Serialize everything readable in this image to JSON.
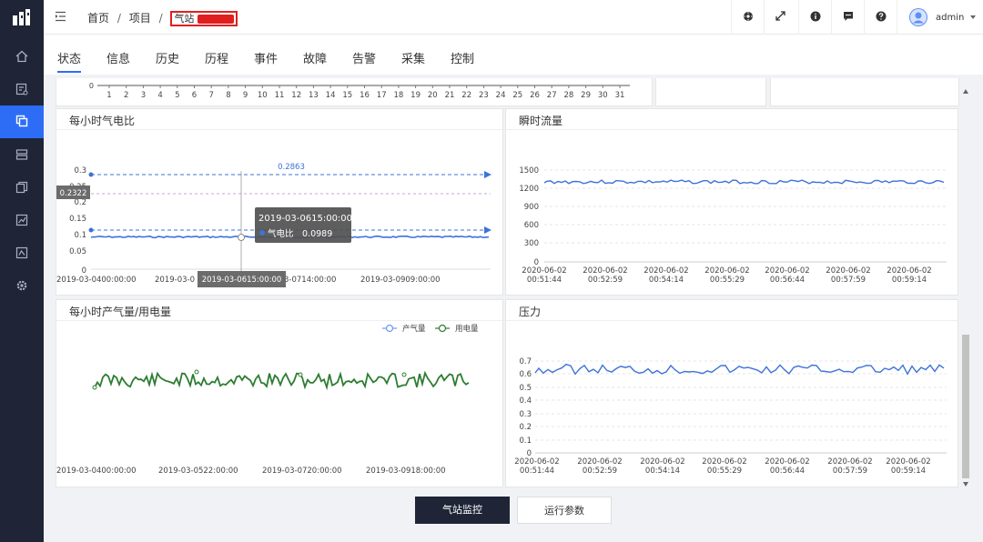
{
  "breadcrumb": {
    "home": "首页",
    "sep1": "/",
    "project": "项目",
    "sep2": "/",
    "station": "气站"
  },
  "user": {
    "name": "admin"
  },
  "topbar_icons": [
    "locate-icon",
    "expand-icon",
    "info-icon",
    "message-icon",
    "help-icon"
  ],
  "sidebar_icons": [
    "home-icon",
    "device-list-icon",
    "station-icon",
    "storage-icon",
    "copy-icon",
    "chart-icon",
    "report-icon",
    "settings-icon"
  ],
  "tabs": [
    "状态",
    "信息",
    "历史",
    "历程",
    "事件",
    "故障",
    "告警",
    "采集",
    "控制"
  ],
  "active_tab": "状态",
  "colors": {
    "accent": "#2d6df6",
    "sidebar_bg": "#1f2536",
    "series_blue": "#3d72d9",
    "series_green": "#2e7d32"
  },
  "top_strip": {
    "y_tick": "0",
    "days": [
      "1",
      "2",
      "3",
      "4",
      "5",
      "6",
      "7",
      "8",
      "9",
      "10",
      "11",
      "12",
      "13",
      "14",
      "15",
      "16",
      "17",
      "18",
      "19",
      "20",
      "21",
      "22",
      "23",
      "24",
      "25",
      "26",
      "27",
      "28",
      "29",
      "30",
      "31"
    ]
  },
  "charts": {
    "gas_ratio": {
      "title": "每小时气电比",
      "y_ticks": [
        "0.3",
        "0.25",
        "0.2",
        "0.15",
        "0.1",
        "0.05",
        "0"
      ],
      "x_labels": [
        "2019-03-0400:00:00",
        "2019-03-0",
        "2019-03-0615:00:00",
        "3-0714:00:00",
        "2019-03-0909:00:00"
      ],
      "markline_top": "0.2863",
      "cursor_y_label": "0.2322",
      "tooltip_time": "2019-03-0615:00:00",
      "tooltip_series": "气电比",
      "tooltip_value": "0.0989",
      "axis_pointer_label": "2019-03-0615:00:00"
    },
    "flow": {
      "title": "瞬时流量",
      "y_ticks": [
        "1500",
        "1200",
        "900",
        "600",
        "300",
        "0"
      ],
      "x_dates": [
        "2020-06-02",
        "2020-06-02",
        "2020-06-02",
        "2020-06-02",
        "2020-06-02",
        "2020-06-02",
        "2020-06-02"
      ],
      "x_times": [
        "00:51:44",
        "00:52:59",
        "00:54:14",
        "00:55:29",
        "00:56:44",
        "00:57:59",
        "00:59:14"
      ]
    },
    "production": {
      "title": "每小时产气量/用电量",
      "legend": [
        "产气量",
        "用电量"
      ],
      "x_labels": [
        "2019-03-0400:00:00",
        "2019-03-0522:00:00",
        "2019-03-0720:00:00",
        "2019-03-0918:00:00"
      ]
    },
    "pressure": {
      "title": "压力",
      "y_ticks": [
        "0.7",
        "0.6",
        "0.5",
        "0.4",
        "0.3",
        "0.2",
        "0.1",
        "0"
      ],
      "x_dates": [
        "2020-06-02",
        "2020-06-02",
        "2020-06-02",
        "2020-06-02",
        "2020-06-02",
        "2020-06-02",
        "2020-06-02"
      ],
      "x_times": [
        "00:51:44",
        "00:52:59",
        "00:54:14",
        "00:55:29",
        "00:56:44",
        "00:57:59",
        "00:59:14"
      ]
    }
  },
  "buttons": {
    "monitor": "气站监控",
    "params": "运行参数"
  }
}
